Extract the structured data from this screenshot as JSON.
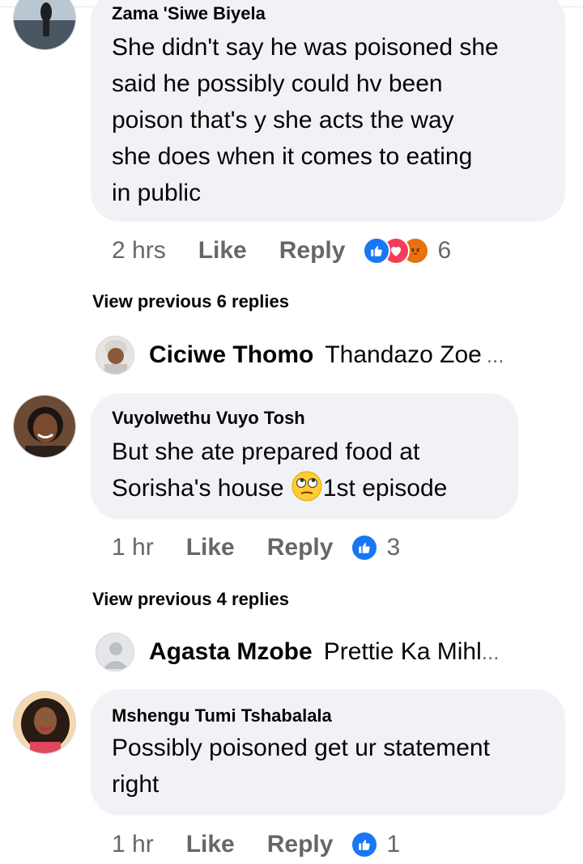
{
  "comments": [
    {
      "author": "Zama 'Siwe Biyela",
      "lines": [
        "She didn't say he was poisoned she",
        "said he possibly could hv been",
        "poison that's y she acts the way",
        "she does when it comes to eating",
        "in public"
      ],
      "time": "2 hrs",
      "like_label": "Like",
      "reply_label": "Reply",
      "reactions": [
        "like-icon",
        "love-icon",
        "angry-icon"
      ],
      "reaction_count": "6"
    },
    {
      "author": "Vuyolwethu Vuyo Tosh",
      "lines": [
        "But she ate prepared food at",
        "Sorisha's house",
        "1st episode"
      ],
      "time": "1 hr",
      "like_label": "Like",
      "reply_label": "Reply",
      "reactions": [
        "like-icon"
      ],
      "reaction_count": "3"
    },
    {
      "author": "Mshengu Tumi Tshabalala",
      "lines": [
        "Possibly poisoned get ur statement",
        "right"
      ],
      "time": "1 hr",
      "like_label": "Like",
      "reply_label": "Reply",
      "reactions": [
        "like-icon"
      ],
      "reaction_count": "1"
    }
  ],
  "reply_threads": [
    {
      "view_previous": "View previous 6 replies",
      "name": "Ciciwe Thomo",
      "text": "Thandazo Zoe",
      "ellipsis": "..."
    },
    {
      "view_previous": "View previous 4 replies",
      "name": "Agasta Mzobe",
      "text": "Prettie Ka Mihl",
      "ellipsis": "..."
    }
  ],
  "colors": {
    "like_blue": "#1877f2",
    "love_red": "#f33e58",
    "angry_orange": "#e9710f",
    "bubble_gray": "#f0f2f5",
    "meta_gray": "#65676b"
  }
}
